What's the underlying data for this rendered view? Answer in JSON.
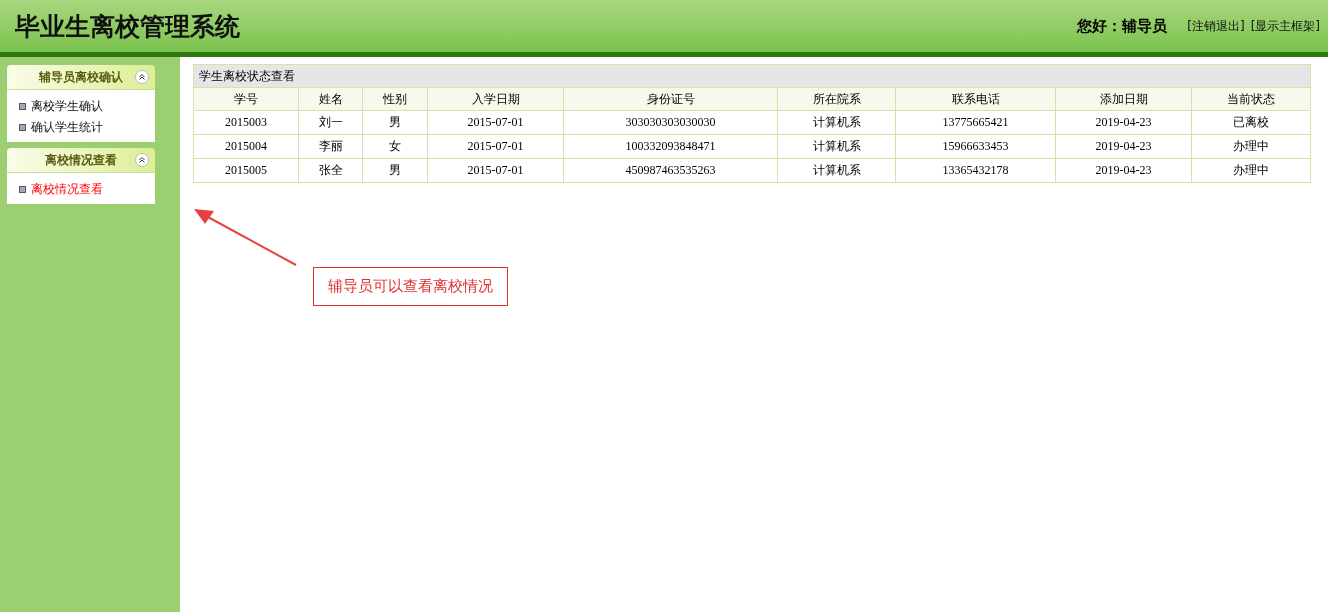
{
  "header": {
    "title": "毕业生离校管理系统",
    "greeting": "您好：辅导员",
    "links": [
      "[注销退出]",
      "[显示主框架]"
    ]
  },
  "sidebar": {
    "groups": [
      {
        "title": "辅导员离校确认",
        "expanded": true,
        "items": [
          {
            "label": "离校学生确认",
            "selected": false
          },
          {
            "label": "确认学生统计",
            "selected": false
          }
        ]
      },
      {
        "title": "离校情况查看",
        "expanded": true,
        "items": [
          {
            "label": "离校情况查看",
            "selected": true
          }
        ]
      }
    ]
  },
  "table": {
    "caption": "学生离校状态查看",
    "columns": [
      "学号",
      "姓名",
      "性别",
      "入学日期",
      "身份证号",
      "所在院系",
      "联系电话",
      "添加日期",
      "当前状态"
    ],
    "rows": [
      [
        "2015003",
        "刘一",
        "男",
        "2015-07-01",
        "303030303030030",
        "计算机系",
        "13775665421",
        "2019-04-23",
        "已离校"
      ],
      [
        "2015004",
        "李丽",
        "女",
        "2015-07-01",
        "100332093848471",
        "计算机系",
        "15966633453",
        "2019-04-23",
        "办理中"
      ],
      [
        "2015005",
        "张全",
        "男",
        "2015-07-01",
        "450987463535263",
        "计算机系",
        "13365432178",
        "2019-04-23",
        "办理中"
      ]
    ]
  },
  "annotation": {
    "text": "辅导员可以查看离校情况"
  }
}
